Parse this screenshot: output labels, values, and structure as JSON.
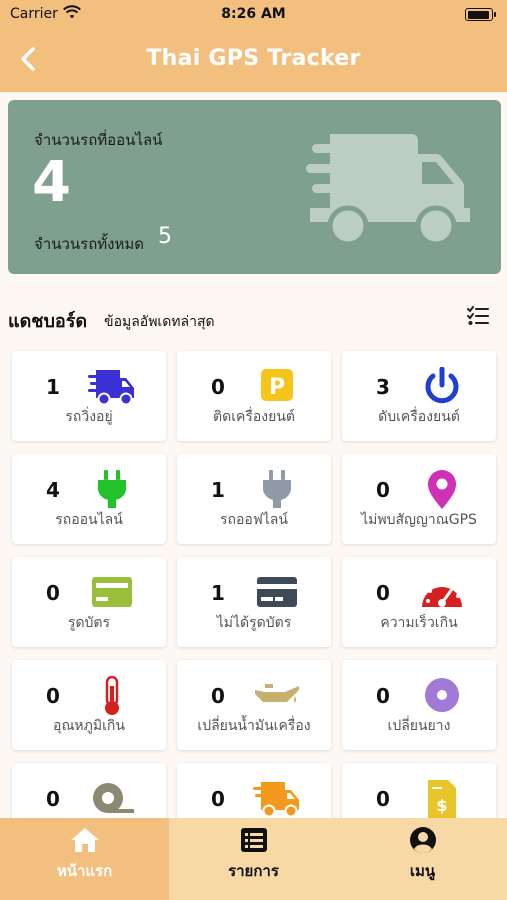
{
  "status_bar": {
    "carrier": "Carrier",
    "time": "8:26 AM"
  },
  "header": {
    "title": "Thai GPS Tracker"
  },
  "summary": {
    "online_label": "จำนวนรถที่ออนไลน์",
    "online_value": "4",
    "total_label": "จำนวนรถทั้งหมด",
    "total_value": "5",
    "icon": "delivery-truck-icon"
  },
  "dashboard": {
    "title": "แดชบอร์ด",
    "subtitle": "ข้อมูลอัพเดทล่าสุด"
  },
  "tiles": [
    {
      "count": "1",
      "label": "รถวิ่งอยู่",
      "icon": "running-truck-icon",
      "color": "#3b2fd6"
    },
    {
      "count": "0",
      "label": "ติดเครื่องยนต์",
      "icon": "parking-icon",
      "color": "#f5c518"
    },
    {
      "count": "3",
      "label": "ดับเครื่องยนต์",
      "icon": "power-icon",
      "color": "#1f3fd0"
    },
    {
      "count": "4",
      "label": "รถออนไลน์",
      "icon": "plug-online-icon",
      "color": "#22c22b"
    },
    {
      "count": "1",
      "label": "รถออฟไลน์",
      "icon": "plug-offline-icon",
      "color": "#8f9aa6"
    },
    {
      "count": "0",
      "label": "ไม่พบสัญญาณGPS",
      "icon": "map-pin-icon",
      "color": "#d12fb6"
    },
    {
      "count": "0",
      "label": "รูดบัตร",
      "icon": "card-swipe-icon",
      "color": "#9bbf3a"
    },
    {
      "count": "1",
      "label": "ไม่ได้รูดบัตร",
      "icon": "card-no-swipe-icon",
      "color": "#3f4a58"
    },
    {
      "count": "0",
      "label": "ความเร็วเกิน",
      "icon": "speedometer-icon",
      "color": "#d81f1f"
    },
    {
      "count": "0",
      "label": "อุณหภูมิเกิน",
      "icon": "thermometer-icon",
      "color": "#d81f1f"
    },
    {
      "count": "0",
      "label": "เปลี่ยนน้ำมันเครื่อง",
      "icon": "oil-can-icon",
      "color": "#c7b06e"
    },
    {
      "count": "0",
      "label": "เปลี่ยนยาง",
      "icon": "tire-icon",
      "color": "#a07ad6"
    },
    {
      "count": "0",
      "label": "",
      "icon": "tape-roll-icon",
      "color": "#8a8a72"
    },
    {
      "count": "0",
      "label": "",
      "icon": "delivery-truck-orange-icon",
      "color": "#f39a1c"
    },
    {
      "count": "0",
      "label": "",
      "icon": "invoice-dollar-icon",
      "color": "#e9c52a"
    }
  ],
  "bottom_nav": [
    {
      "label": "หน้าแรก",
      "icon": "home-icon",
      "active": true
    },
    {
      "label": "รายการ",
      "icon": "list-icon",
      "active": false
    },
    {
      "label": "เมนู",
      "icon": "user-circle-icon",
      "active": false
    }
  ]
}
